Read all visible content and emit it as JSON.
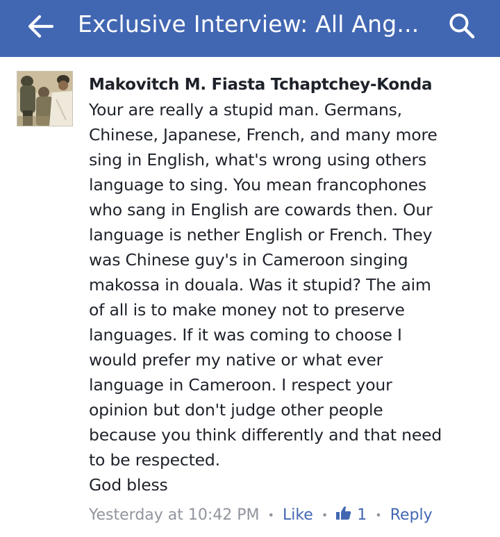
{
  "header": {
    "title": "Exclusive Interview: All Ang...",
    "background_color": "#4267b2",
    "back_icon": "arrow-left-icon",
    "search_icon": "search-icon"
  },
  "comment": {
    "author": "Makovitch M. Fiasta Tchaptchey-Konda",
    "avatar_icon": "profile-photo",
    "lines": [
      "Your are really a stupid man. Germans,",
      "Chinese, Japanese, French, and many more",
      "sing in English, what's wrong using others",
      "language to sing. You mean francophones",
      "who sang in English are cowards then. Our",
      "language is nether English or French. They",
      "was Chinese guy's in Cameroon singing",
      "makossa in douala. Was it stupid? The aim",
      "of all is to make money not to preserve",
      "languages. If it was coming to choose I",
      "would prefer my native or what ever",
      "language in Cameroon. I respect your",
      "opinion but don't judge other people",
      "because you think differently and that need",
      "to be respected.",
      "God bless"
    ],
    "timestamp": "Yesterday at 10:42 PM",
    "separator": "•",
    "like_label": "Like",
    "like_count": "1",
    "reply_label": "Reply",
    "link_color": "#4267b2",
    "meta_color": "#90949c"
  }
}
